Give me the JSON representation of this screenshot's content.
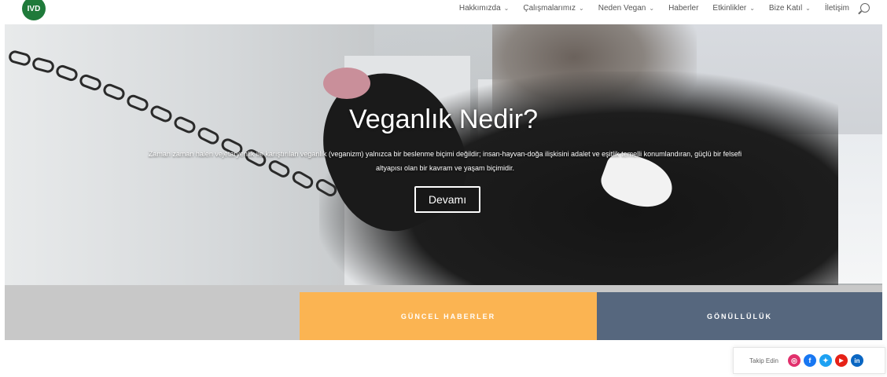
{
  "header": {
    "logo_text": "IVD",
    "nav": [
      {
        "label": "Hakkımızda",
        "has_dropdown": true
      },
      {
        "label": "Çalışmalarımız",
        "has_dropdown": true
      },
      {
        "label": "Neden Vegan",
        "has_dropdown": true
      },
      {
        "label": "Haberler",
        "has_dropdown": false
      },
      {
        "label": "Etkinlikler",
        "has_dropdown": true
      },
      {
        "label": "Bize Katıl",
        "has_dropdown": true
      },
      {
        "label": "İletişim",
        "has_dropdown": false
      }
    ],
    "chevron": "⌄"
  },
  "hero": {
    "title": "Veganlık Nedir?",
    "description": "Zaman zaman halen vejetaryenlik ile karıştırılan veganlık (veganizm) yalnızca bir beslenme biçimi değildir; insan-hayvan-doğa ilişkisini adalet ve eşitlik temelli konumlandıran, güçlü bir felsefi altyapısı olan bir kavram ve yaşam biçimidir.",
    "button_label": "Devamı"
  },
  "band": {
    "news_label": "GÜNCEL HABERLER",
    "volunteer_label": "GÖNÜLLÜLÜK",
    "colors": {
      "news": "#fbb452",
      "volunteer": "#56677e",
      "left": "#c8c8c8"
    }
  },
  "follow": {
    "label": "Takip Edin",
    "icons": [
      {
        "name": "instagram-icon",
        "glyph": "◎",
        "color": "#e1306c"
      },
      {
        "name": "facebook-icon",
        "glyph": "f",
        "color": "#1877f2"
      },
      {
        "name": "twitter-icon",
        "glyph": "✦",
        "color": "#1da1f2"
      },
      {
        "name": "youtube-icon",
        "glyph": "▶",
        "color": "#e62117"
      },
      {
        "name": "linkedin-icon",
        "glyph": "in",
        "color": "#0a66c2"
      }
    ]
  }
}
